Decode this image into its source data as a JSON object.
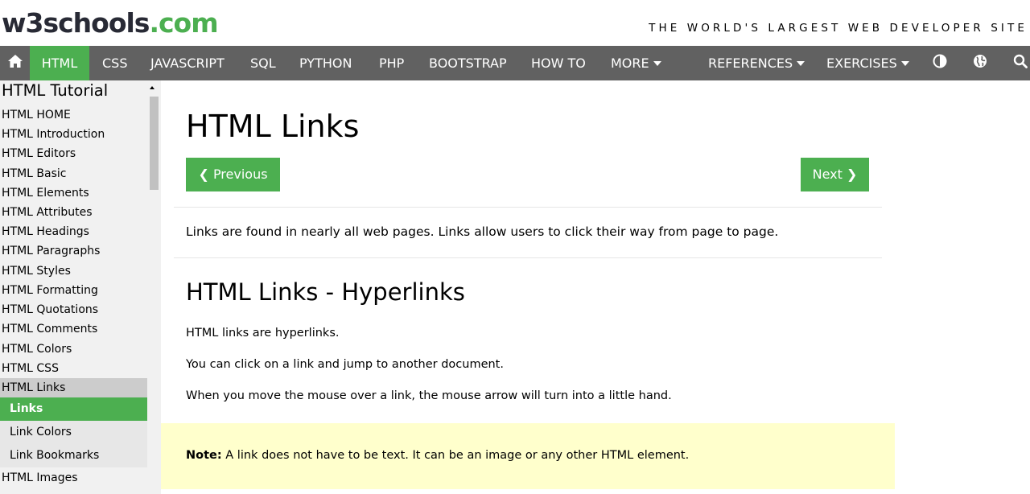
{
  "header": {
    "logo_main": "w3schools",
    "logo_suffix": ".com",
    "tagline": "THE WORLD'S LARGEST WEB DEVELOPER SITE"
  },
  "nav": {
    "home_icon": "home-icon",
    "items": [
      {
        "label": "HTML",
        "active": true
      },
      {
        "label": "CSS"
      },
      {
        "label": "JAVASCRIPT"
      },
      {
        "label": "SQL"
      },
      {
        "label": "PYTHON"
      },
      {
        "label": "PHP"
      },
      {
        "label": "BOOTSTRAP"
      },
      {
        "label": "HOW TO"
      },
      {
        "label": "MORE"
      },
      {
        "label": "REFERENCES"
      },
      {
        "label": "EXERCISES"
      }
    ],
    "icons": [
      "contrast-icon",
      "globe-icon",
      "search-icon"
    ],
    "active_color": "#4caf50",
    "bar_color": "#616161"
  },
  "sidebar": {
    "title": "HTML Tutorial",
    "items": [
      "HTML HOME",
      "HTML Introduction",
      "HTML Editors",
      "HTML Basic",
      "HTML Elements",
      "HTML Attributes",
      "HTML Headings",
      "HTML Paragraphs",
      "HTML Styles",
      "HTML Formatting",
      "HTML Quotations",
      "HTML Comments",
      "HTML Colors",
      "HTML CSS",
      "HTML Links"
    ],
    "sub_items": [
      "Links",
      "Link Colors",
      "Link Bookmarks"
    ],
    "after_items": [
      "HTML Images"
    ]
  },
  "main": {
    "title": "HTML Links",
    "prev_label": "Previous",
    "next_label": "Next",
    "intro": "Links are found in nearly all web pages. Links allow users to click their way from page to page.",
    "section_title": "HTML Links - Hyperlinks",
    "p1": "HTML links are hyperlinks.",
    "p2": "You can click on a link and jump to another document.",
    "p3": "When you move the mouse over a link, the mouse arrow will turn into a little hand.",
    "note_label": "Note:",
    "note_text": "A link does not have to be text. It can be an image or any other HTML element.",
    "note_bg": "#ffffcc"
  }
}
